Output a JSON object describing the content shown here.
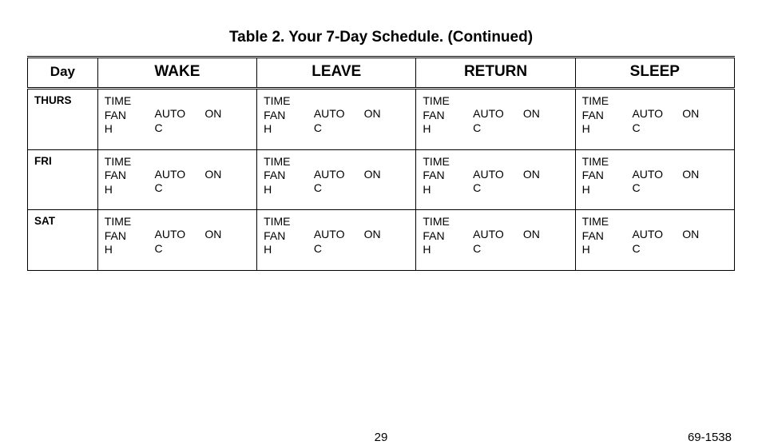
{
  "title": "Table 2. Your 7-Day Schedule. (Continued)",
  "headers": {
    "day": "Day",
    "col1": "WAKE",
    "col2": "LEAVE",
    "col3": "RETURN",
    "col4": "SLEEP"
  },
  "cell_template": {
    "l1": "TIME",
    "l2": "FAN",
    "l3": "H",
    "m1": "AUTO",
    "m2": "C",
    "r1": "ON"
  },
  "rows": [
    {
      "day": "THURS"
    },
    {
      "day": "FRI"
    },
    {
      "day": "SAT"
    }
  ],
  "footer": {
    "page_number": "29",
    "doc_id": "69-1538"
  },
  "chart_data": {
    "type": "table",
    "title": "Table 2. Your 7-Day Schedule. (Continued)",
    "columns": [
      "Day",
      "WAKE",
      "LEAVE",
      "RETURN",
      "SLEEP"
    ],
    "cell_fields": [
      "TIME",
      "FAN",
      "H",
      "AUTO",
      "C",
      "ON"
    ],
    "rows": [
      {
        "Day": "THURS",
        "WAKE": {
          "TIME": "",
          "FAN": "",
          "H": "",
          "AUTO": "",
          "C": "",
          "ON": ""
        },
        "LEAVE": {
          "TIME": "",
          "FAN": "",
          "H": "",
          "AUTO": "",
          "C": "",
          "ON": ""
        },
        "RETURN": {
          "TIME": "",
          "FAN": "",
          "H": "",
          "AUTO": "",
          "C": "",
          "ON": ""
        },
        "SLEEP": {
          "TIME": "",
          "FAN": "",
          "H": "",
          "AUTO": "",
          "C": "",
          "ON": ""
        }
      },
      {
        "Day": "FRI",
        "WAKE": {
          "TIME": "",
          "FAN": "",
          "H": "",
          "AUTO": "",
          "C": "",
          "ON": ""
        },
        "LEAVE": {
          "TIME": "",
          "FAN": "",
          "H": "",
          "AUTO": "",
          "C": "",
          "ON": ""
        },
        "RETURN": {
          "TIME": "",
          "FAN": "",
          "H": "",
          "AUTO": "",
          "C": "",
          "ON": ""
        },
        "SLEEP": {
          "TIME": "",
          "FAN": "",
          "H": "",
          "AUTO": "",
          "C": "",
          "ON": ""
        }
      },
      {
        "Day": "SAT",
        "WAKE": {
          "TIME": "",
          "FAN": "",
          "H": "",
          "AUTO": "",
          "C": "",
          "ON": ""
        },
        "LEAVE": {
          "TIME": "",
          "FAN": "",
          "H": "",
          "AUTO": "",
          "C": "",
          "ON": ""
        },
        "RETURN": {
          "TIME": "",
          "FAN": "",
          "H": "",
          "AUTO": "",
          "C": "",
          "ON": ""
        },
        "SLEEP": {
          "TIME": "",
          "FAN": "",
          "H": "",
          "AUTO": "",
          "C": "",
          "ON": ""
        }
      }
    ]
  }
}
